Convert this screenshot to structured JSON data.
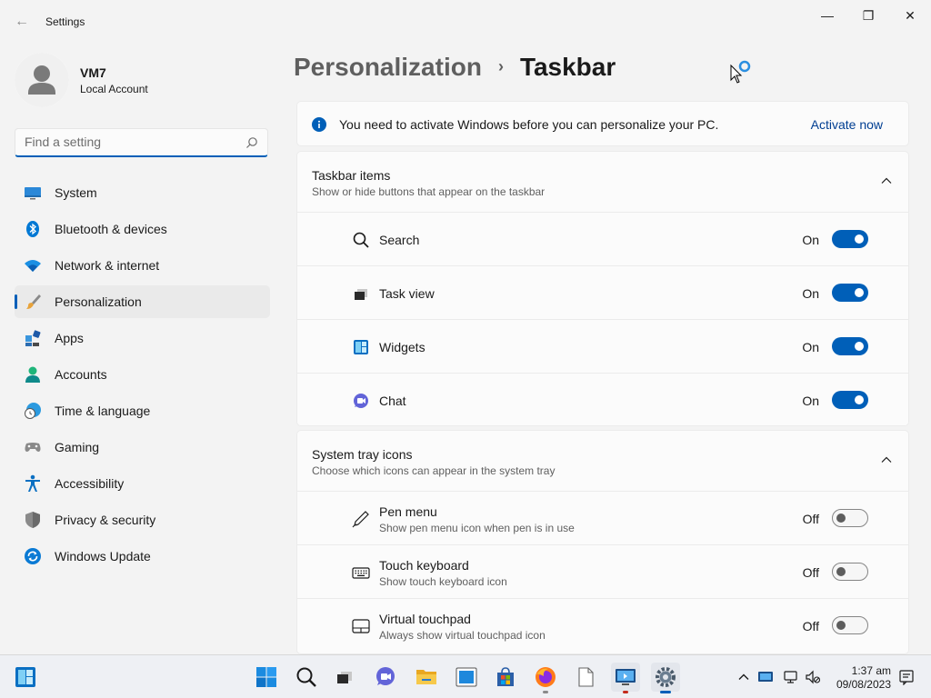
{
  "window": {
    "title": "Settings",
    "back_glyph": "←",
    "minimize_glyph": "—",
    "maximize_glyph": "❐",
    "close_glyph": "✕"
  },
  "profile": {
    "name": "VM7",
    "account_type": "Local Account"
  },
  "search": {
    "placeholder": "Find a setting",
    "value": ""
  },
  "accent_color": "#005fb8",
  "sidebar": {
    "items": [
      {
        "label": "System",
        "icon": "monitor-icon",
        "selected": false
      },
      {
        "label": "Bluetooth & devices",
        "icon": "bluetooth-icon",
        "selected": false
      },
      {
        "label": "Network & internet",
        "icon": "wifi-icon",
        "selected": false
      },
      {
        "label": "Personalization",
        "icon": "paintbrush-icon",
        "selected": true
      },
      {
        "label": "Apps",
        "icon": "apps-icon",
        "selected": false
      },
      {
        "label": "Accounts",
        "icon": "person-icon",
        "selected": false
      },
      {
        "label": "Time & language",
        "icon": "globe-clock-icon",
        "selected": false
      },
      {
        "label": "Gaming",
        "icon": "gamepad-icon",
        "selected": false
      },
      {
        "label": "Accessibility",
        "icon": "accessibility-icon",
        "selected": false
      },
      {
        "label": "Privacy & security",
        "icon": "shield-icon",
        "selected": false
      },
      {
        "label": "Windows Update",
        "icon": "update-icon",
        "selected": false
      }
    ]
  },
  "header": {
    "parent": "Personalization",
    "separator": "›",
    "current": "Taskbar"
  },
  "activation_banner": {
    "message": "You need to activate Windows before you can personalize your PC.",
    "action": "Activate now"
  },
  "taskbar_items": {
    "title": "Taskbar items",
    "subtitle": "Show or hide buttons that appear on the taskbar",
    "rows": [
      {
        "label": "Search",
        "state": "On",
        "icon": "search-icon"
      },
      {
        "label": "Task view",
        "state": "On",
        "icon": "task-view-icon"
      },
      {
        "label": "Widgets",
        "state": "On",
        "icon": "widgets-icon"
      },
      {
        "label": "Chat",
        "state": "On",
        "icon": "chat-icon"
      }
    ]
  },
  "system_tray": {
    "title": "System tray icons",
    "subtitle": "Choose which icons can appear in the system tray",
    "rows": [
      {
        "label": "Pen menu",
        "description": "Show pen menu icon when pen is in use",
        "state": "Off",
        "icon": "pen-icon"
      },
      {
        "label": "Touch keyboard",
        "description": "Show touch keyboard icon",
        "state": "Off",
        "icon": "keyboard-icon"
      },
      {
        "label": "Virtual touchpad",
        "description": "Always show virtual touchpad icon",
        "state": "Off",
        "icon": "touchpad-icon"
      }
    ]
  },
  "taskbar": {
    "apps": [
      "widgets-icon",
      "start-icon",
      "search-icon",
      "task-view-icon",
      "chat-icon",
      "file-explorer-icon",
      "tablet-icon",
      "store-icon",
      "firefox-icon",
      "notepad-icon",
      "remote-desktop-icon",
      "settings-icon"
    ],
    "clock": {
      "time": "1:37 am",
      "date": "09/08/2023"
    }
  }
}
